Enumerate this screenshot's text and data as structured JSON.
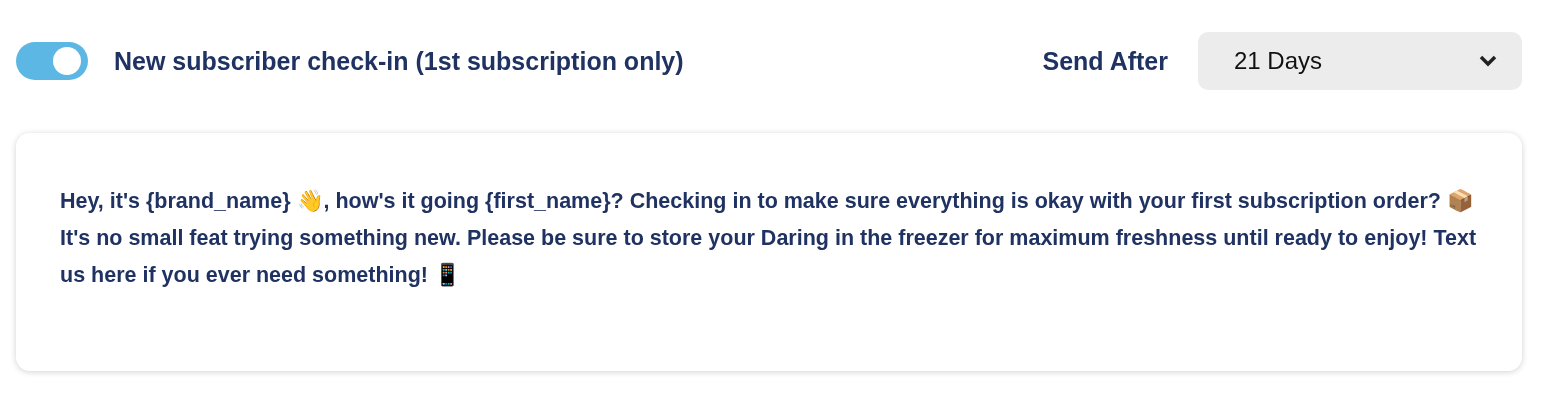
{
  "toggle": {
    "on": true,
    "label": "New subscriber check-in (1st subscription only)"
  },
  "send_after": {
    "label": "Send After",
    "value": "21 Days"
  },
  "message": {
    "text": "Hey, it's {brand_name} 👋, how's it going {first_name}? Checking in to make sure everything is okay with your first subscription order? 📦 It's no small feat trying something new. Please be sure to store your Daring in the freezer for maximum freshness until ready to enjoy! Text us here if you ever need something! 📱"
  }
}
